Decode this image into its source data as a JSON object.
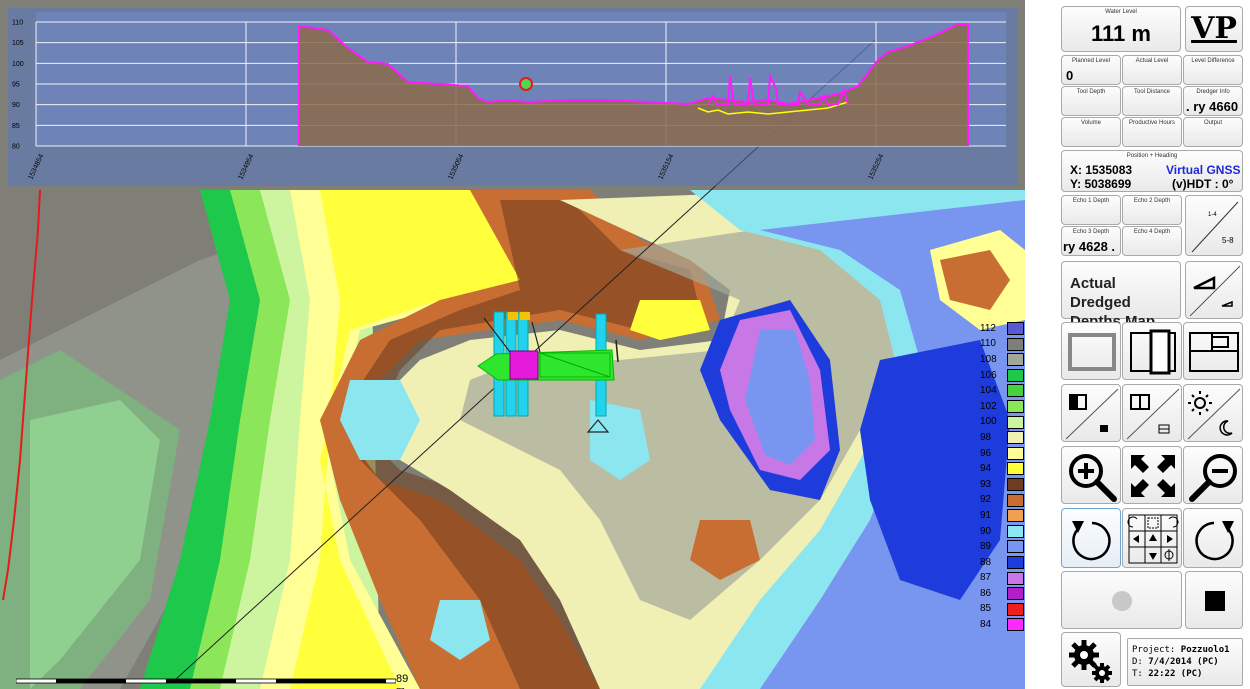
{
  "profile": {
    "y_ticks": [
      "110",
      "105",
      "100",
      "95",
      "90",
      "85",
      "80"
    ],
    "x_ticks": [
      "1534854",
      "1534954",
      "1535054",
      "1535154",
      "1535254"
    ]
  },
  "legend": {
    "items": [
      {
        "label": "112",
        "color": "#5a5ad2"
      },
      {
        "label": "110",
        "color": "#7d7f79"
      },
      {
        "label": "108",
        "color": "#a3a79a"
      },
      {
        "label": "106",
        "color": "#1ec84a"
      },
      {
        "label": "104",
        "color": "#46d23c"
      },
      {
        "label": "102",
        "color": "#8ce65a"
      },
      {
        "label": "100",
        "color": "#cdf5a0"
      },
      {
        "label": "98",
        "color": "#f0f0b4"
      },
      {
        "label": "96",
        "color": "#ffff96"
      },
      {
        "label": "94",
        "color": "#ffff3c"
      },
      {
        "label": "93",
        "color": "#6e3c1e"
      },
      {
        "label": "92",
        "color": "#c86e32"
      },
      {
        "label": "91",
        "color": "#f0a050"
      },
      {
        "label": "90",
        "color": "#8ce6f0"
      },
      {
        "label": "89",
        "color": "#7896f0"
      },
      {
        "label": "88",
        "color": "#1e3cdc"
      },
      {
        "label": "87",
        "color": "#c878e6"
      },
      {
        "label": "86",
        "color": "#b41ec8"
      },
      {
        "label": "85",
        "color": "#f01e1e"
      },
      {
        "label": "84",
        "color": "#ff28ff"
      }
    ]
  },
  "scalebar": {
    "label": "89 m"
  },
  "panel": {
    "water_level": {
      "title": "Water Level",
      "value": "111 m"
    },
    "logo": "VP",
    "planned_level": {
      "title": "Planned Level",
      "value": "0"
    },
    "actual_level": {
      "title": "Actual Level",
      "value": ""
    },
    "level_difference": {
      "title": "Level Difference",
      "value": ""
    },
    "tool_depth": {
      "title": "Tool Depth",
      "value": ""
    },
    "tool_distance": {
      "title": "Tool Distance",
      "value": ""
    },
    "dredger_info": {
      "title": "Dredger Info",
      "value": "ry 4660 ."
    },
    "volume": {
      "title": "Volume",
      "value": ""
    },
    "productive_hours": {
      "title": "Productive Hours",
      "value": ""
    },
    "output": {
      "title": "Output",
      "value": ""
    },
    "position": {
      "title": "Position + Heading",
      "x": "X: 1535083",
      "y": "Y: 5038699",
      "source": "Virtual GNSS",
      "heading": "(v)HDT : 0°"
    },
    "echo1": {
      "title": "Echo 1 Depth",
      "value": ""
    },
    "echo2": {
      "title": "Echo 2 Depth",
      "value": ""
    },
    "echo3": {
      "title": "Echo 3 Depth",
      "value": "ry 4628 ."
    },
    "echo4": {
      "title": "Echo 4 Depth",
      "value": ""
    },
    "echo_toggle": {
      "top": "1-4",
      "bottom": "5-8"
    },
    "map_type": {
      "line1": "Actual Dredged",
      "line2": "Depths Map"
    },
    "project": {
      "project_label": "Project:",
      "project_value": "Pozzuolo1",
      "date_label": "D:",
      "date_value": "7/4/2014 (PC)",
      "time_label": "T:",
      "time_value": "22:22 (PC)"
    }
  }
}
